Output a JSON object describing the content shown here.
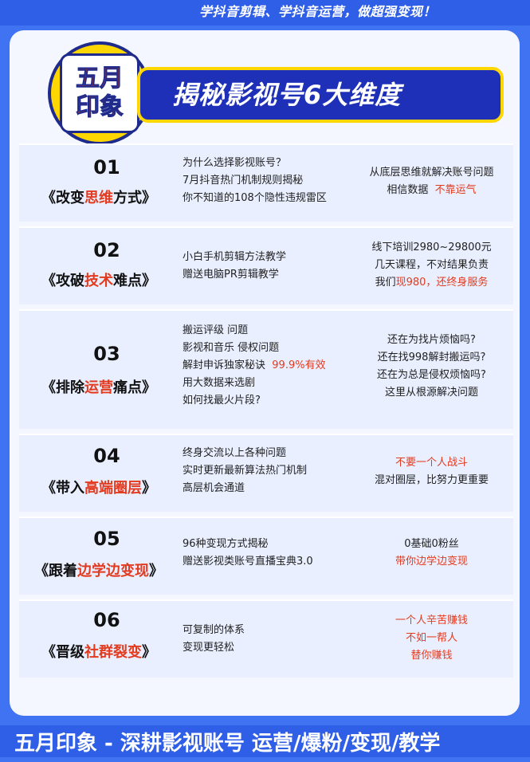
{
  "header": {
    "slogan": "学抖音剪辑、学抖音运营，做超强变现！",
    "logo_line1": "五月",
    "logo_line2": "印象",
    "banner_title": "揭秘影视号6大维度"
  },
  "rows": [
    {
      "num": "01",
      "title_pre": "《改变",
      "title_hl": "思维",
      "title_post": "方式》",
      "mid": [
        "为什么选择影视账号？",
        "7月抖音热门机制规则揭秘",
        "你不知道的108个隐性违规雷区"
      ],
      "right": [
        "从底层思维就解决账号问题"
      ],
      "right_mixed_pre": "相信数据",
      "right_mixed_red": "不靠运气"
    },
    {
      "num": "02",
      "title_pre": "《攻破",
      "title_hl": "技术",
      "title_post": "难点》",
      "mid": [
        "小白手机剪辑方法教学",
        "赠送电脑PR剪辑教学"
      ],
      "right": [
        "线下培训2980~29800元",
        "几天课程，不对结果负责"
      ],
      "right_mixed_pre": "我们",
      "right_mixed_red": "现980，还终身服务"
    },
    {
      "num": "03",
      "title_pre": "《排除",
      "title_hl": "运营",
      "title_post": "痛点》",
      "mid1": "搬运评级 问题",
      "mid2": "影视和音乐 侵权问题",
      "mid3_pre": "解封申诉独家秘诀",
      "mid3_red": "99.9%有效",
      "mid4": "用大数据来选剧",
      "mid5": "如何找最火片段?",
      "right": [
        "还在为找片烦恼吗?",
        "还在找998解封搬运吗?",
        "还在为总是侵权烦恼吗?",
        "这里从根源解决问题"
      ]
    },
    {
      "num": "04",
      "title_pre": "《带入",
      "title_hl": "高端圈层",
      "title_post": "》",
      "mid": [
        "终身交流以上各种问题",
        "实时更新最新算法热门机制",
        "高层机会通道"
      ],
      "right_red": "不要一个人战斗",
      "right": [
        "混对圈层，比努力更重要"
      ]
    },
    {
      "num": "05",
      "title_pre": "《跟着",
      "title_hl": "边学边变现",
      "title_post": "》",
      "mid": [
        "96种变现方式揭秘",
        "赠送影视类账号直播宝典3.0"
      ],
      "right": [
        "0基础0粉丝"
      ],
      "right_red": "带你边学边变现"
    },
    {
      "num": "06",
      "title_pre": "《晋级",
      "title_hl": "社群裂变",
      "title_post": "》",
      "mid": [
        "可复制的体系",
        "变现更轻松"
      ],
      "right_red_lines": [
        "一个人辛苦赚钱",
        "不如一帮人",
        "替你赚钱"
      ]
    }
  ],
  "footer": {
    "text": "五月印象 - 深耕影视账号 运营/爆粉/变现/教学"
  },
  "colors": {
    "background": "#3f73f2",
    "accent_red": "#e33b1f",
    "yellow": "#ffd700",
    "navy": "#1e2b8c"
  }
}
